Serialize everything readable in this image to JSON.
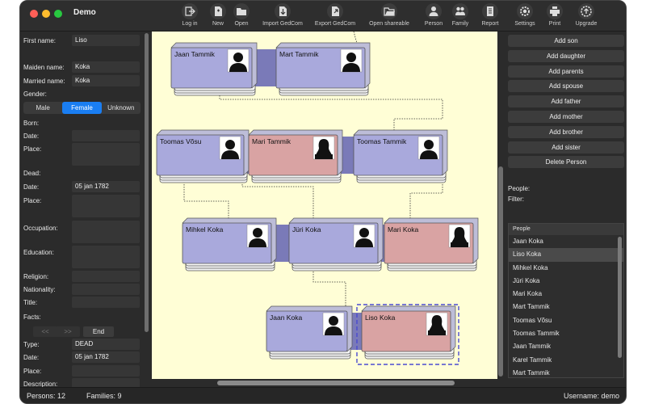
{
  "window": {
    "title": "Demo"
  },
  "toolbar": [
    {
      "name": "login-button",
      "icon": "login-icon",
      "label": "Log in"
    },
    {
      "name": "new-button",
      "icon": "new-file-icon",
      "label": "New"
    },
    {
      "name": "open-button",
      "icon": "folder-icon",
      "label": "Open"
    },
    {
      "name": "import-gedcom-button",
      "icon": "import-icon",
      "label": "Import GedCom"
    },
    {
      "name": "export-gedcom-button",
      "icon": "export-icon",
      "label": "Export GedCom"
    },
    {
      "name": "open-shareable-button",
      "icon": "open-folder-icon",
      "label": "Open shareable"
    },
    {
      "name": "person-button",
      "icon": "person-icon",
      "label": "Person"
    },
    {
      "name": "family-button",
      "icon": "family-icon",
      "label": "Family"
    },
    {
      "name": "report-button",
      "icon": "report-icon",
      "label": "Report"
    },
    {
      "name": "settings-button",
      "icon": "gear-icon",
      "label": "Settings"
    },
    {
      "name": "print-button",
      "icon": "printer-icon",
      "label": "Print"
    },
    {
      "name": "upgrade-button",
      "icon": "upgrade-icon",
      "label": "Upgrade"
    }
  ],
  "person_form": {
    "first_name_label": "First name:",
    "first_name_value": "Liso",
    "maiden_name_label": "Maiden name:",
    "maiden_name_value": "Koka",
    "married_name_label": "Married name:",
    "married_name_value": "Koka",
    "gender_label": "Gender:",
    "gender_options": [
      "Male",
      "Female",
      "Unknown"
    ],
    "born_label": "Born:",
    "born_date_label": "Date:",
    "born_date_value": "",
    "born_place_label": "Place:",
    "dead_label": "Dead:",
    "dead_date_label": "Date:",
    "dead_date_value": "05 jan 1782",
    "dead_place_label": "Place:",
    "occupation_label": "Occupation:",
    "education_label": "Education:",
    "religion_label": "Religion:",
    "nationality_label": "Nationality:",
    "title_label": "Title:",
    "facts_label": "Facts:",
    "facts_nav": [
      "<<",
      ">>",
      "End"
    ],
    "fact_type_label": "Type:",
    "fact_type_value": "DEAD",
    "fact_date_label": "Date:",
    "fact_date_value": "05 jan 1782",
    "fact_place_label": "Place:",
    "fact_description_label": "Description:"
  },
  "tree": {
    "cards": [
      {
        "id": "jaan1",
        "name": "Jaan Tammik",
        "gender": "male"
      },
      {
        "id": "mart",
        "name": "Mart Tammik",
        "gender": "male"
      },
      {
        "id": "toomasv",
        "name": "Toomas Võsu",
        "gender": "male"
      },
      {
        "id": "mari_t",
        "name": "Mari Tammik",
        "gender": "female"
      },
      {
        "id": "toomast",
        "name": "Toomas Tammik",
        "gender": "male"
      },
      {
        "id": "mihkel",
        "name": "Mihkel Koka",
        "gender": "male"
      },
      {
        "id": "juri",
        "name": "Jüri Koka",
        "gender": "male"
      },
      {
        "id": "mari_k",
        "name": "Mari Koka",
        "gender": "female"
      },
      {
        "id": "jaank",
        "name": "Jaan Koka",
        "gender": "male"
      },
      {
        "id": "liso",
        "name": "Liso Koka",
        "gender": "female",
        "selected": true
      }
    ],
    "colors": {
      "male": "#a9a9dc",
      "female": "#d9a3a3",
      "couple_link": "#7a7ab8",
      "background": "#fffed6",
      "selection": "#4a4ad0"
    }
  },
  "actions": {
    "buttons": [
      "Add son",
      "Add daughter",
      "Add parents",
      "Add spouse",
      "Add father",
      "Add mother",
      "Add brother",
      "Add sister",
      "Delete Person"
    ],
    "people_label": "People:",
    "filter_label": "Filter:",
    "list_header": "People",
    "people": [
      "Jaan Koka",
      "Liso Koka",
      "Mihkel Koka",
      "Jüri Koka",
      "Mari Koka",
      "Mart Tammik",
      "Toomas Võsu",
      "Toomas Tammik",
      "Jaan Tammik",
      "Karel Tammik",
      "Mart Tammik"
    ],
    "selected_person": "Liso Koka"
  },
  "status": {
    "persons": "Persons: 12",
    "families": "Families: 9",
    "username": "Username: demo"
  }
}
